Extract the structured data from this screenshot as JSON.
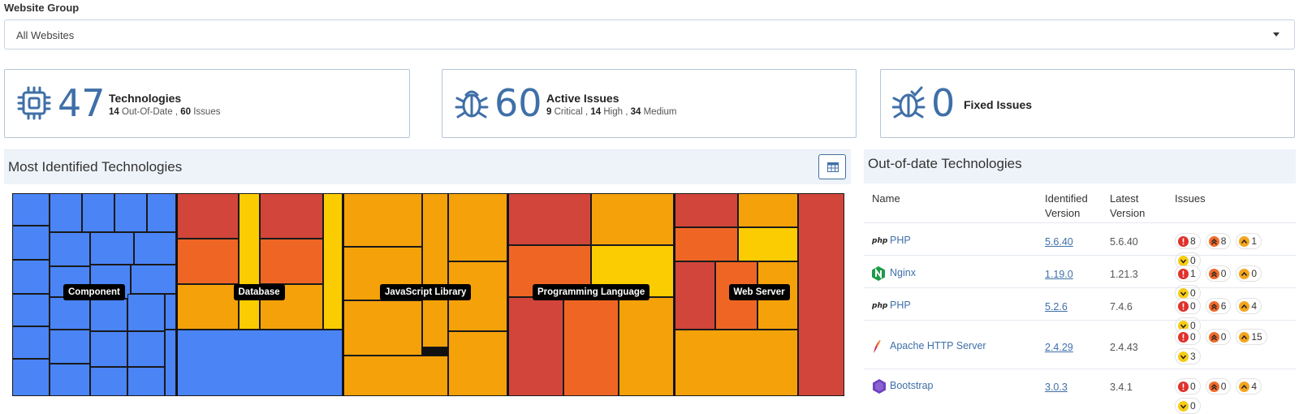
{
  "filter": {
    "label": "Website Group",
    "value": "All Websites"
  },
  "cards": {
    "technologies": {
      "count": "47",
      "title": "Technologies",
      "n1": "14",
      "t1": "Out-Of-Date ,",
      "n2": "60",
      "t2": "Issues"
    },
    "active": {
      "count": "60",
      "title": "Active Issues",
      "n1": "9",
      "t1": "Critical ,",
      "n2": "14",
      "t2": "High ,",
      "n3": "34",
      "t3": "Medium"
    },
    "fixed": {
      "count": "0",
      "title": "Fixed Issues"
    }
  },
  "treemap": {
    "title": "Most Identified Technologies",
    "labels": [
      "Component",
      "Database",
      "JavaScript Library",
      "Programming Language",
      "Web Server"
    ],
    "colors": {
      "blue": "#4a84f5",
      "red": "#d2453a",
      "orange": "#ef6624",
      "amber": "#f5a10a",
      "yellow": "#fbcc02"
    }
  },
  "outdated": {
    "title": "Out-of-date Technologies",
    "headers": {
      "name": "Name",
      "identified": "Identified Version",
      "latest": "Latest Version",
      "issues": "Issues"
    },
    "rows": [
      {
        "icon": "php-logo-icon",
        "name": "PHP",
        "identified": "5.6.40",
        "latest": "5.6.40",
        "c": "8",
        "h": "8",
        "m": "1",
        "l": "0"
      },
      {
        "icon": "nginx-logo-icon",
        "name": "Nginx",
        "identified": "1.19.0",
        "latest": "1.21.3",
        "c": "1",
        "h": "0",
        "m": "0",
        "l": "0"
      },
      {
        "icon": "php-logo-icon",
        "name": "PHP",
        "identified": "5.2.6",
        "latest": "7.4.6",
        "c": "0",
        "h": "6",
        "m": "4",
        "l": "0"
      },
      {
        "icon": "apache-feather-icon",
        "name": "Apache HTTP Server",
        "identified": "2.4.29",
        "latest": "2.4.43",
        "c": "0",
        "h": "0",
        "m": "15",
        "l": "3"
      },
      {
        "icon": "bootstrap-logo-icon",
        "name": "Bootstrap",
        "identified": "3.0.3",
        "latest": "3.4.1",
        "c": "0",
        "h": "0",
        "m": "4",
        "l": "0"
      }
    ],
    "severity_colors": {
      "critical": "#e0312b",
      "high": "#f06b2a",
      "medium": "#f5a51d",
      "low": "#f7cc15"
    }
  }
}
